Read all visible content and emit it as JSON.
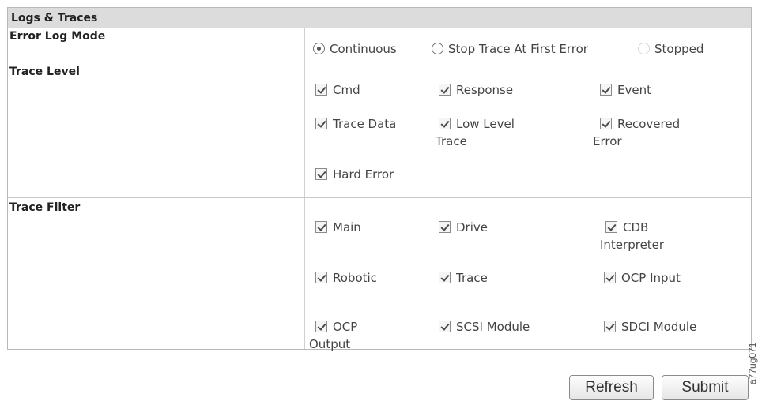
{
  "header": {
    "title": "Logs & Traces"
  },
  "error_log_mode": {
    "label": "Error Log Mode",
    "options": [
      {
        "label": "Continuous",
        "selected": true,
        "enabled": true
      },
      {
        "label": "Stop Trace At First Error",
        "selected": false,
        "enabled": true
      },
      {
        "label": "Stopped",
        "selected": false,
        "enabled": false
      }
    ]
  },
  "trace_level": {
    "label": "Trace Level",
    "items": [
      {
        "line1": "Cmd",
        "line2": "",
        "checked": true
      },
      {
        "line1": "Response",
        "line2": "",
        "checked": true
      },
      {
        "line1": "Event",
        "line2": "",
        "checked": true
      },
      {
        "line1": "Trace Data",
        "line2": "",
        "checked": true
      },
      {
        "line1": "Low Level",
        "line2": "Trace",
        "checked": true
      },
      {
        "line1": "Recovered",
        "line2": "Error",
        "checked": true
      },
      {
        "line1": "Hard Error",
        "line2": "",
        "checked": true
      }
    ]
  },
  "trace_filter": {
    "label": "Trace Filter",
    "items": [
      {
        "line1": "Main",
        "line2": "",
        "checked": true
      },
      {
        "line1": "Drive",
        "line2": "",
        "checked": true
      },
      {
        "line1": "CDB",
        "line2": "Interpreter",
        "checked": true
      },
      {
        "line1": "Robotic",
        "line2": "",
        "checked": true
      },
      {
        "line1": "Trace",
        "line2": "",
        "checked": true
      },
      {
        "line1": "OCP Input",
        "line2": "",
        "checked": true
      },
      {
        "line1": "OCP",
        "line2": "Output",
        "checked": true
      },
      {
        "line1": "SCSI Module",
        "line2": "",
        "checked": true
      },
      {
        "line1": "SDCI Module",
        "line2": "",
        "checked": true
      }
    ]
  },
  "buttons": {
    "refresh": "Refresh",
    "submit": "Submit"
  },
  "figure_id": "a77ug071"
}
